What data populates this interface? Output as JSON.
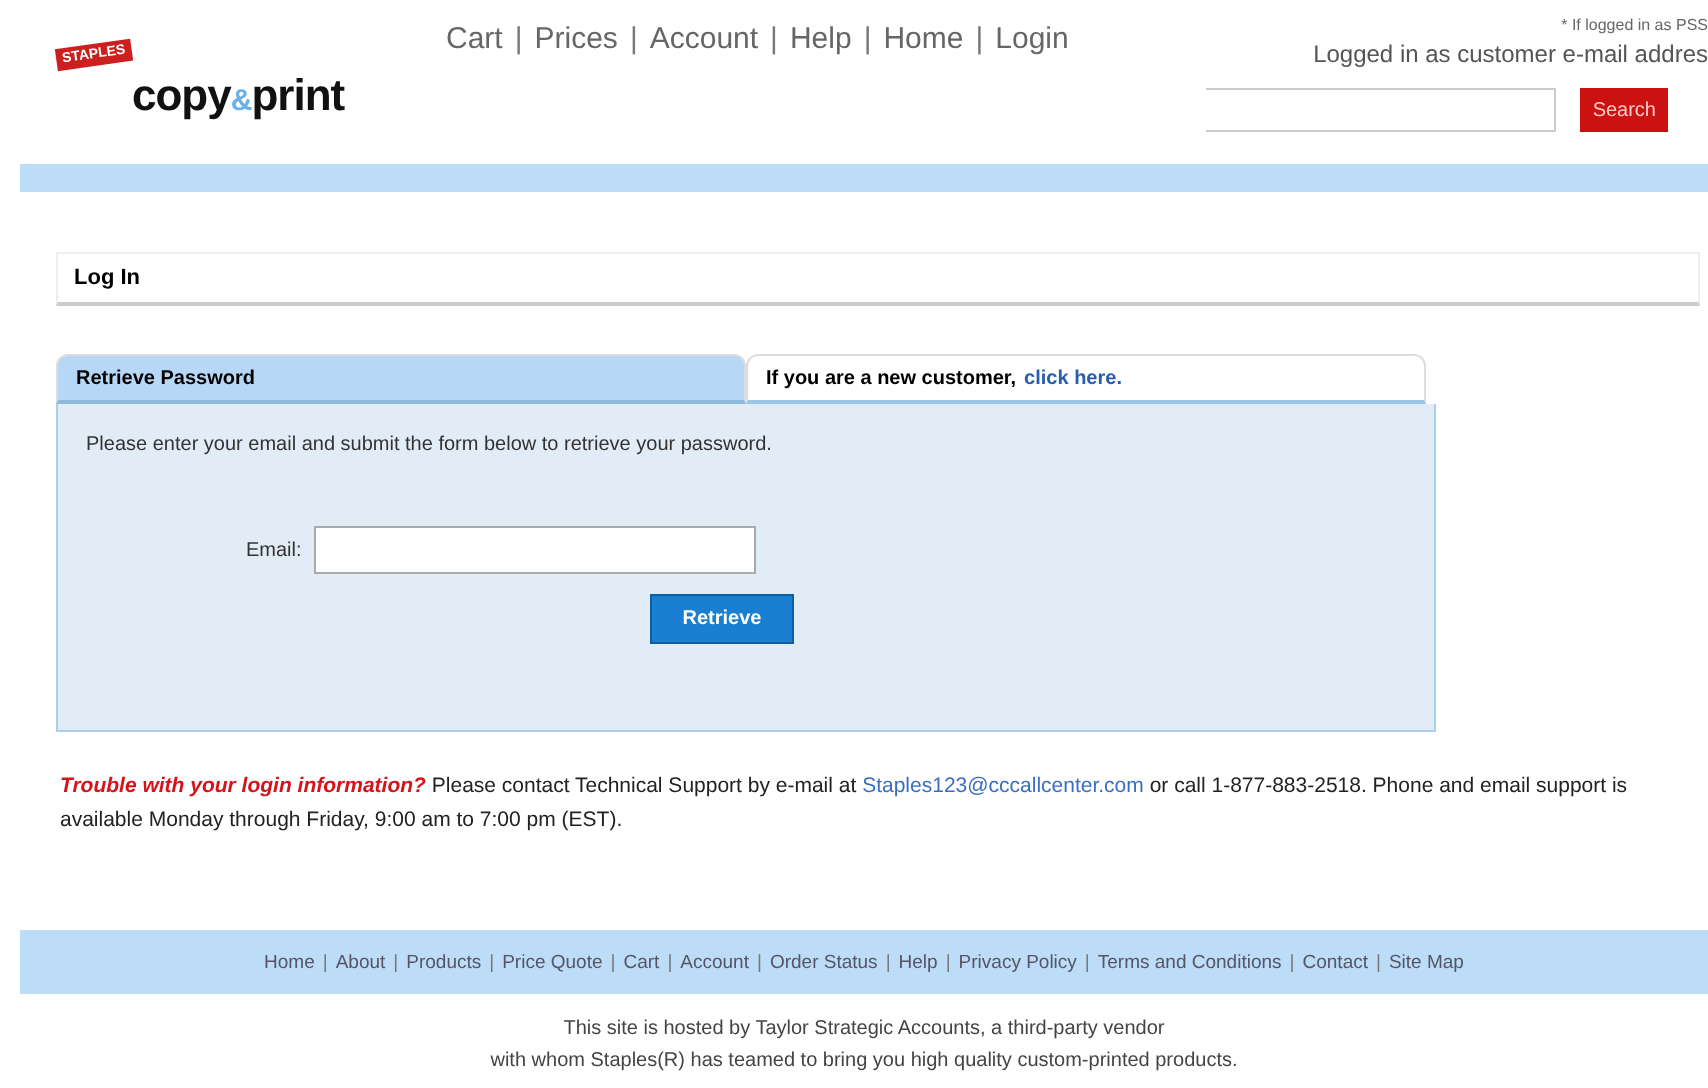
{
  "header": {
    "logo": {
      "tag": "STAPLES",
      "word": "copy",
      "amp": "&",
      "word2": "print"
    },
    "nav": {
      "links": [
        "Cart",
        "Prices",
        "Account",
        "Help",
        "Home",
        "Login"
      ],
      "separator": "|"
    },
    "note": "* If logged in as PSS",
    "status": "Logged in as customer e-mail addres",
    "search": {
      "button": "Search"
    }
  },
  "section_title": "Log In",
  "tabs": [
    {
      "label": "Retrieve Password",
      "selected": true
    },
    {
      "label": "If you are a new customer,",
      "link": "click here.",
      "selected": false
    }
  ],
  "form": {
    "instructions": "Please enter your email and submit the form below to retrieve your password.",
    "email_label": "Email:",
    "button": "Retrieve"
  },
  "support": {
    "lead": "Trouble with your login information?",
    "before_link": "Please contact Technical Support by e-mail at",
    "link": "Staples123@cccallcenter.com",
    "after_link": "or call 1-877-883-2518.  Phone and email support is available Monday through Friday, 9:00 am to 7:00 pm (EST)."
  },
  "footer": {
    "links": [
      "Home",
      "About",
      "Products",
      "Price Quote",
      "Cart",
      "Account",
      "Order Status",
      "Help",
      "Privacy Policy",
      "Terms and Conditions",
      "Contact",
      "Site Map"
    ],
    "separator": "|",
    "lines": [
      "This site is hosted by Taylor Strategic Accounts, a third-party vendor",
      "with whom Staples(R) has teamed to bring you high quality custom-printed products."
    ]
  }
}
